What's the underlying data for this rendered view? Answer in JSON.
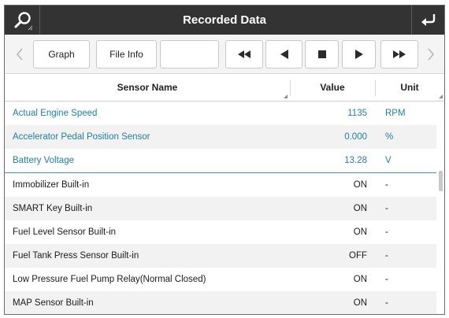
{
  "window": {
    "title": "Recorded Data",
    "left_icon": "search-icon",
    "right_icon": "back-return-icon"
  },
  "toolbar": {
    "prev_icon": "chevron-left-icon",
    "graph_label": "Graph",
    "file_info_label": "File Info",
    "blank_label": "",
    "rewind_icon": "rewind-icon",
    "step_back_icon": "play-reverse-icon",
    "stop_icon": "stop-icon",
    "play_icon": "play-icon",
    "fast_forward_icon": "fast-forward-icon",
    "next_icon": "chevron-right-icon"
  },
  "table": {
    "headers": {
      "name": "Sensor Name",
      "value": "Value",
      "unit": "Unit"
    },
    "rows": [
      {
        "name": "Actual Engine Speed",
        "value": "1135",
        "unit": "RPM"
      },
      {
        "name": "Accelerator Pedal Position Sensor",
        "value": "0.000",
        "unit": "%"
      },
      {
        "name": "Battery Voltage",
        "value": "13.28",
        "unit": "V"
      },
      {
        "name": "Immobilizer Built-in",
        "value": "ON",
        "unit": "-"
      },
      {
        "name": "SMART Key Built-in",
        "value": "ON",
        "unit": "-"
      },
      {
        "name": "Fuel Level Sensor Built-in",
        "value": "ON",
        "unit": "-"
      },
      {
        "name": "Fuel Tank Press Sensor Built-in",
        "value": "OFF",
        "unit": "-"
      },
      {
        "name": "Low Pressure Fuel Pump Relay(Normal Closed)",
        "value": "ON",
        "unit": "-"
      },
      {
        "name": "MAP Sensor Built-in",
        "value": "ON",
        "unit": "-"
      }
    ]
  },
  "colors": {
    "titlebar": "#333333",
    "highlight_text": "#1f7f9e",
    "divider": "#4a8fab",
    "alt_row": "#f2f2f2"
  }
}
